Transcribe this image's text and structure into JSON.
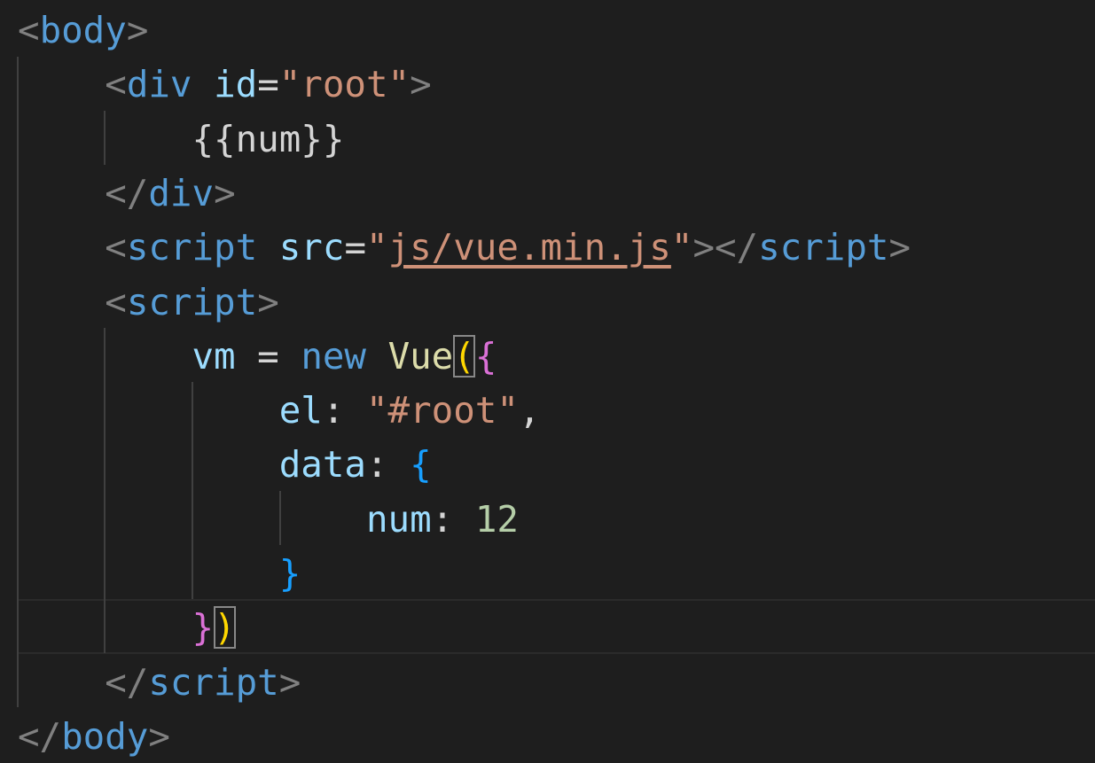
{
  "editor": {
    "lines": [
      {
        "indent": "",
        "tokens": [
          {
            "t": "<",
            "c": "punct"
          },
          {
            "t": "body",
            "c": "tag"
          },
          {
            "t": ">",
            "c": "punct"
          }
        ]
      },
      {
        "indent": "    ",
        "tokens": [
          {
            "t": "<",
            "c": "punct"
          },
          {
            "t": "div",
            "c": "tag"
          },
          {
            "t": " ",
            "c": "plain"
          },
          {
            "t": "id",
            "c": "attr"
          },
          {
            "t": "=",
            "c": "plain"
          },
          {
            "t": "\"root\"",
            "c": "str"
          },
          {
            "t": ">",
            "c": "punct"
          }
        ]
      },
      {
        "indent": "        ",
        "tokens": [
          {
            "t": "{{num}}",
            "c": "plain"
          }
        ]
      },
      {
        "indent": "    ",
        "tokens": [
          {
            "t": "</",
            "c": "punct"
          },
          {
            "t": "div",
            "c": "tag"
          },
          {
            "t": ">",
            "c": "punct"
          }
        ]
      },
      {
        "indent": "    ",
        "tokens": [
          {
            "t": "<",
            "c": "punct"
          },
          {
            "t": "script",
            "c": "tag"
          },
          {
            "t": " ",
            "c": "plain"
          },
          {
            "t": "src",
            "c": "attr"
          },
          {
            "t": "=",
            "c": "plain"
          },
          {
            "t": "\"",
            "c": "str"
          },
          {
            "t": "js/vue.min.js",
            "c": "str link"
          },
          {
            "t": "\"",
            "c": "str"
          },
          {
            "t": "></",
            "c": "punct"
          },
          {
            "t": "script",
            "c": "tag"
          },
          {
            "t": ">",
            "c": "punct"
          }
        ]
      },
      {
        "indent": "    ",
        "tokens": [
          {
            "t": "<",
            "c": "punct"
          },
          {
            "t": "script",
            "c": "tag"
          },
          {
            "t": ">",
            "c": "punct"
          }
        ]
      },
      {
        "indent": "        ",
        "tokens": [
          {
            "t": "vm",
            "c": "var"
          },
          {
            "t": " = ",
            "c": "plain"
          },
          {
            "t": "new",
            "c": "kw"
          },
          {
            "t": " ",
            "c": "plain"
          },
          {
            "t": "Vue",
            "c": "cls"
          },
          {
            "t": "(",
            "c": "paren-gold bracket-match"
          },
          {
            "t": "{",
            "c": "brace-pink"
          }
        ]
      },
      {
        "indent": "            ",
        "tokens": [
          {
            "t": "el",
            "c": "var"
          },
          {
            "t": ": ",
            "c": "plain"
          },
          {
            "t": "\"#root\"",
            "c": "str"
          },
          {
            "t": ",",
            "c": "plain"
          }
        ]
      },
      {
        "indent": "            ",
        "tokens": [
          {
            "t": "data",
            "c": "var"
          },
          {
            "t": ": ",
            "c": "plain"
          },
          {
            "t": "{",
            "c": "brace-blue"
          }
        ]
      },
      {
        "indent": "                ",
        "tokens": [
          {
            "t": "num",
            "c": "var"
          },
          {
            "t": ": ",
            "c": "plain"
          },
          {
            "t": "12",
            "c": "num"
          }
        ]
      },
      {
        "indent": "            ",
        "tokens": [
          {
            "t": "}",
            "c": "brace-blue"
          }
        ]
      },
      {
        "indent": "        ",
        "tokens": [
          {
            "t": "}",
            "c": "brace-pink"
          },
          {
            "t": ")",
            "c": "paren-gold bracket-match"
          }
        ]
      },
      {
        "indent": "    ",
        "tokens": [
          {
            "t": "</",
            "c": "punct"
          },
          {
            "t": "script",
            "c": "tag"
          },
          {
            "t": ">",
            "c": "punct"
          }
        ]
      },
      {
        "indent": "",
        "tokens": [
          {
            "t": "</",
            "c": "punct"
          },
          {
            "t": "body",
            "c": "tag"
          },
          {
            "t": ">",
            "c": "punct"
          }
        ]
      }
    ]
  }
}
